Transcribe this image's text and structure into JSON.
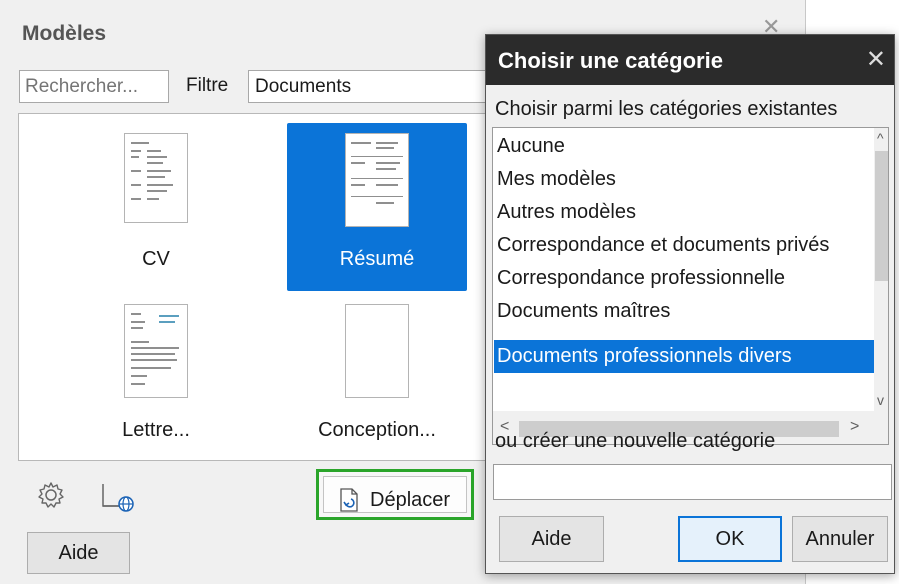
{
  "main_dialog": {
    "title": "Modèles",
    "close_glyph": "✕",
    "search_placeholder": "Rechercher...",
    "filter_label": "Filtre",
    "filter_value": "Documents",
    "templates": [
      {
        "label": "CV",
        "selected": false
      },
      {
        "label": "Résumé",
        "selected": true
      },
      {
        "label": "Lettre...",
        "selected": false
      },
      {
        "label": "Conception...",
        "selected": false
      }
    ],
    "move_button_label": "Déplacer",
    "help_button_label": "Aide",
    "icons": [
      "settings-icon",
      "online-templates-icon",
      "move-document-icon"
    ]
  },
  "category_dialog": {
    "title": "Choisir une catégorie",
    "close_glyph": "✕",
    "choose_label": "Choisir parmi les catégories existantes",
    "categories": [
      "Aucune",
      "Mes modèles",
      "Autres modèles",
      "Correspondance et documents privés",
      "Correspondance professionnelle",
      "Documents maîtres",
      "Documents professionnels divers"
    ],
    "selected_category": "Documents professionnels divers",
    "new_category_label": "ou créer une nouvelle catégorie",
    "new_category_value": "",
    "buttons": {
      "help": "Aide",
      "ok": "OK",
      "cancel": "Annuler"
    }
  },
  "colors": {
    "selection": "#0b74d8",
    "highlight_border": "#2aa52a",
    "titlebar": "#2b2b2b"
  }
}
